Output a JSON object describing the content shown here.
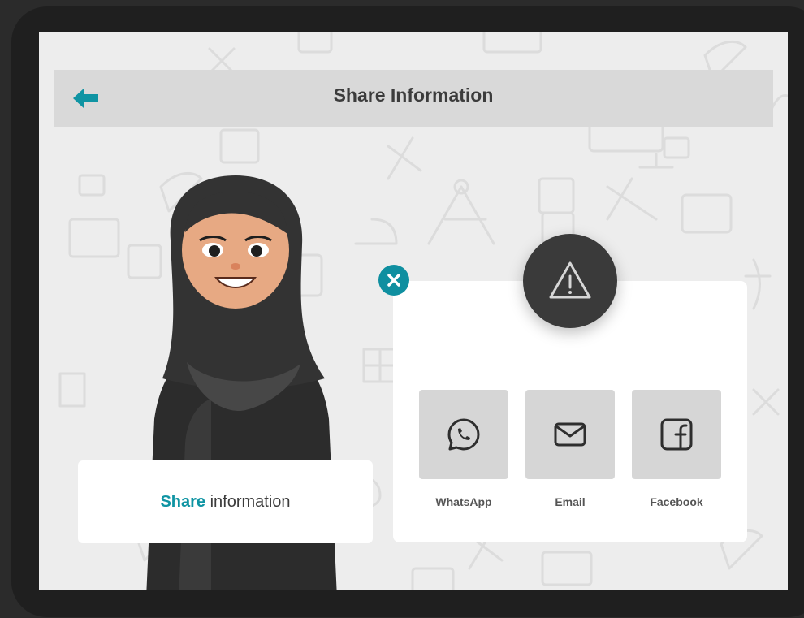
{
  "header": {
    "title": "Share Information",
    "back_icon": "back-arrow-icon"
  },
  "label_card": {
    "highlight": "Share",
    "rest": " information"
  },
  "dialog": {
    "close_icon": "close-icon",
    "alert_icon": "warning-icon",
    "options": [
      {
        "label": "WhatsApp",
        "icon": "whatsapp-icon"
      },
      {
        "label": "Email",
        "icon": "email-icon"
      },
      {
        "label": "Facebook",
        "icon": "facebook-icon"
      }
    ]
  },
  "colors": {
    "accent": "#0f94a3",
    "header_bg": "#d9d9d9",
    "alert_bg": "#3a3a3a",
    "tile_bg": "#d6d6d6",
    "frame": "#1f1f1f"
  }
}
